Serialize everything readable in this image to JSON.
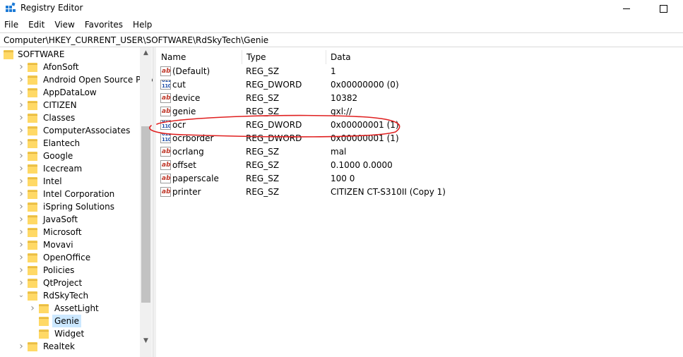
{
  "window": {
    "title": "Registry Editor"
  },
  "menu": [
    "File",
    "Edit",
    "View",
    "Favorites",
    "Help"
  ],
  "address": "Computer\\HKEY_CURRENT_USER\\SOFTWARE\\RdSkyTech\\Genie",
  "tree": [
    {
      "label": "SOFTWARE",
      "level": 0,
      "chevron": "none"
    },
    {
      "label": "AfonSoft",
      "level": 1,
      "chevron": "right"
    },
    {
      "label": "Android Open Source Project",
      "level": 1,
      "chevron": "right"
    },
    {
      "label": "AppDataLow",
      "level": 1,
      "chevron": "right"
    },
    {
      "label": "CITIZEN",
      "level": 1,
      "chevron": "right"
    },
    {
      "label": "Classes",
      "level": 1,
      "chevron": "right"
    },
    {
      "label": "ComputerAssociates",
      "level": 1,
      "chevron": "right"
    },
    {
      "label": "Elantech",
      "level": 1,
      "chevron": "right"
    },
    {
      "label": "Google",
      "level": 1,
      "chevron": "right"
    },
    {
      "label": "Icecream",
      "level": 1,
      "chevron": "right"
    },
    {
      "label": "Intel",
      "level": 1,
      "chevron": "right"
    },
    {
      "label": "Intel Corporation",
      "level": 1,
      "chevron": "right"
    },
    {
      "label": "iSpring Solutions",
      "level": 1,
      "chevron": "right"
    },
    {
      "label": "JavaSoft",
      "level": 1,
      "chevron": "right"
    },
    {
      "label": "Microsoft",
      "level": 1,
      "chevron": "right"
    },
    {
      "label": "Movavi",
      "level": 1,
      "chevron": "right"
    },
    {
      "label": "OpenOffice",
      "level": 1,
      "chevron": "right"
    },
    {
      "label": "Policies",
      "level": 1,
      "chevron": "right"
    },
    {
      "label": "QtProject",
      "level": 1,
      "chevron": "right"
    },
    {
      "label": "RdSkyTech",
      "level": 1,
      "chevron": "down"
    },
    {
      "label": "AssetLight",
      "level": 2,
      "chevron": "right"
    },
    {
      "label": "Genie",
      "level": 2,
      "chevron": "none",
      "selected": true
    },
    {
      "label": "Widget",
      "level": 2,
      "chevron": "none"
    },
    {
      "label": "Realtek",
      "level": 1,
      "chevron": "right"
    }
  ],
  "columns": {
    "name": "Name",
    "type": "Type",
    "data": "Data"
  },
  "values": [
    {
      "icon": "string-value-icon",
      "name": "(Default)",
      "type": "REG_SZ",
      "data": "1"
    },
    {
      "icon": "dword-value-icon",
      "name": "cut",
      "type": "REG_DWORD",
      "data": "0x00000000 (0)"
    },
    {
      "icon": "string-value-icon",
      "name": "device",
      "type": "REG_SZ",
      "data": "10382"
    },
    {
      "icon": "string-value-icon",
      "name": "genie",
      "type": "REG_SZ",
      "data": "gxl://"
    },
    {
      "icon": "dword-value-icon",
      "name": "ocr",
      "type": "REG_DWORD",
      "data": "0x00000001 (1)",
      "highlighted": true
    },
    {
      "icon": "dword-value-icon",
      "name": "ocrborder",
      "type": "REG_DWORD",
      "data": "0x00000001 (1)"
    },
    {
      "icon": "string-value-icon",
      "name": "ocrlang",
      "type": "REG_SZ",
      "data": "mal"
    },
    {
      "icon": "string-value-icon",
      "name": "offset",
      "type": "REG_SZ",
      "data": "0.1000 0.0000"
    },
    {
      "icon": "string-value-icon",
      "name": "paperscale",
      "type": "REG_SZ",
      "data": "100 0"
    },
    {
      "icon": "string-value-icon",
      "name": "printer",
      "type": "REG_SZ",
      "data": "CITIZEN CT-S310II (Copy 1)"
    }
  ],
  "icons": {
    "string_glyph": "ab",
    "dword_glyph": "011\n110"
  },
  "colors": {
    "selection": "#cce8ff",
    "folder": "#ffd966",
    "annotation": "#e02020"
  },
  "tree_scroll": {
    "thumb_fraction": 0.59
  }
}
